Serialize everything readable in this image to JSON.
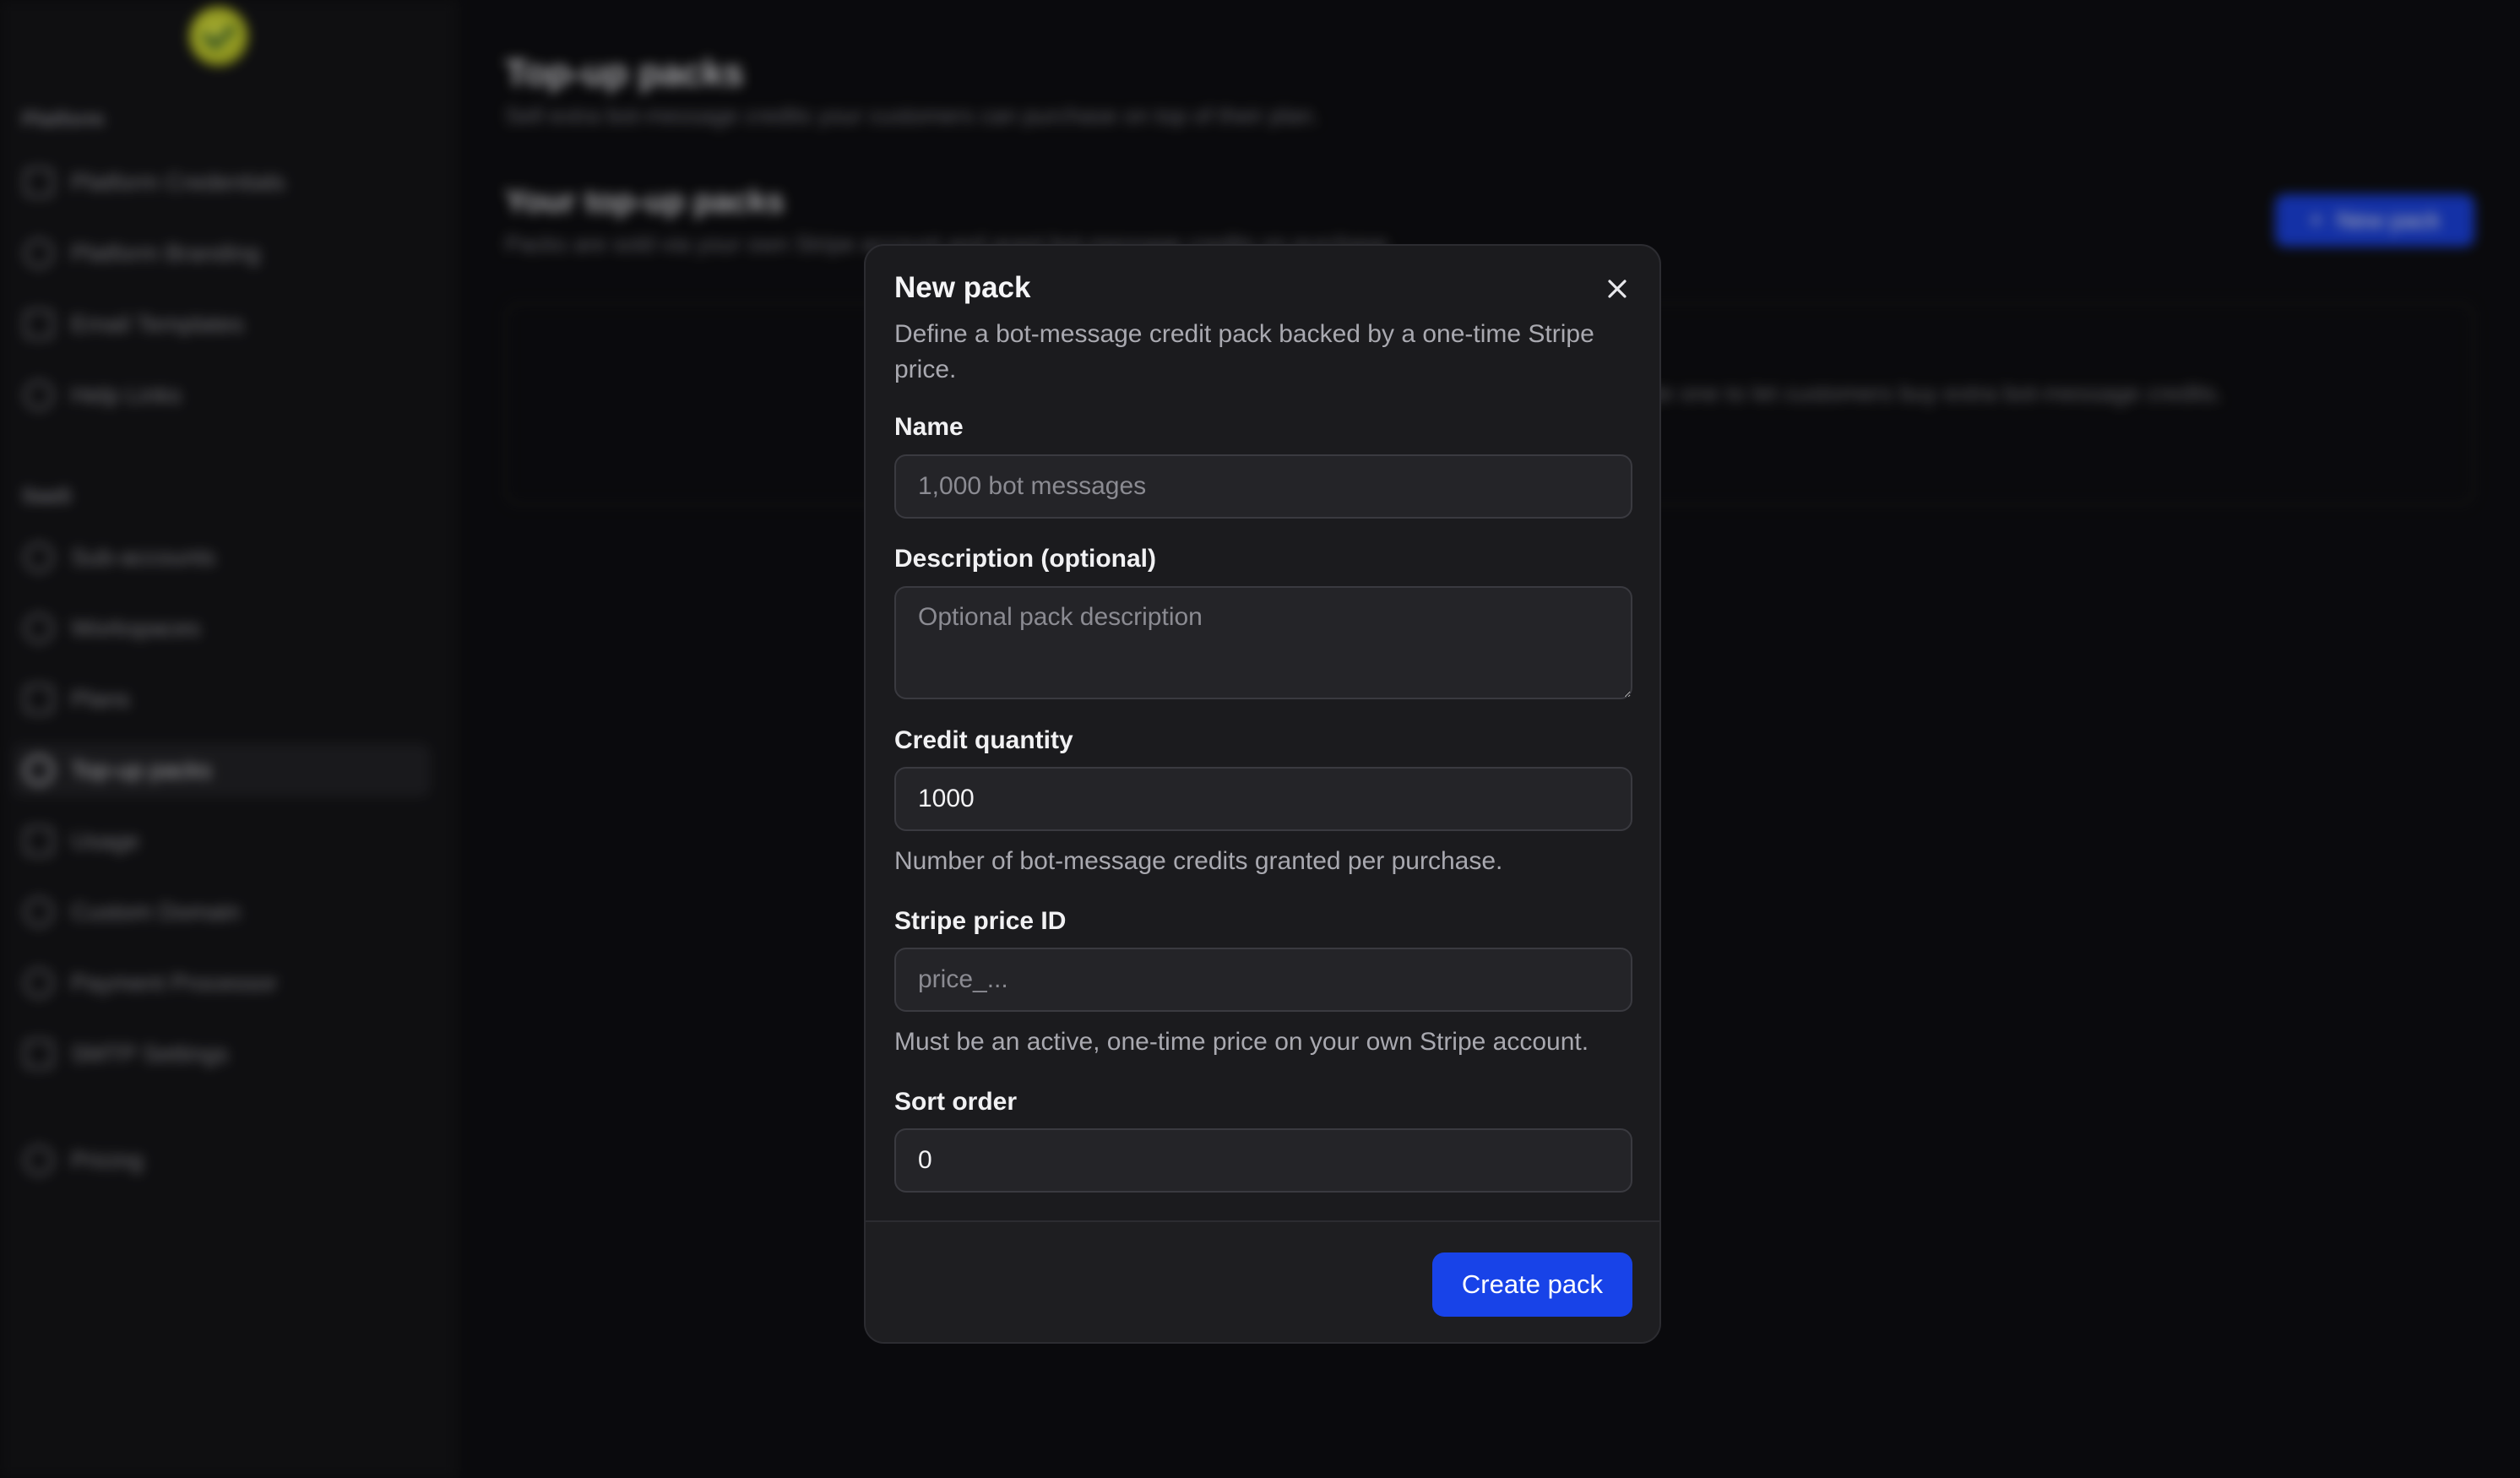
{
  "sidebar": {
    "sections": [
      {
        "label": "Platform",
        "items": [
          {
            "label": "Platform Credentials",
            "icon": "key-icon"
          },
          {
            "label": "Platform Branding",
            "icon": "palette-icon"
          },
          {
            "label": "Email Templates",
            "icon": "mail-icon"
          },
          {
            "label": "Help Links",
            "icon": "help-icon"
          }
        ]
      },
      {
        "label": "SaaS",
        "items": [
          {
            "label": "Sub-accounts",
            "icon": "users-icon"
          },
          {
            "label": "Workspaces",
            "icon": "workspace-icon"
          },
          {
            "label": "Plans",
            "icon": "plans-icon"
          },
          {
            "label": "Top-up packs",
            "icon": "package-icon",
            "active": true
          },
          {
            "label": "Usage",
            "icon": "usage-icon"
          },
          {
            "label": "Custom Domain",
            "icon": "globe-icon"
          },
          {
            "label": "Payment Processor",
            "icon": "card-icon"
          },
          {
            "label": "SMTP Settings",
            "icon": "server-icon"
          }
        ]
      }
    ],
    "footer_item": {
      "label": "Pricing",
      "icon": "tag-icon"
    }
  },
  "main": {
    "title": "Top-up packs",
    "subtitle": "Sell extra bot-message credits your customers can purchase on top of their plan.",
    "section_title": "Your top-up packs",
    "section_subtitle": "Packs are sold via your own Stripe account and grant bot-message credits on purchase.",
    "new_pack_label": "New pack",
    "empty_text": "No packs yet. Create one to let customers buy extra bot-message credits."
  },
  "modal": {
    "title": "New pack",
    "description": "Define a bot-message credit pack backed by a one-time Stripe price.",
    "fields": {
      "name": {
        "label": "Name",
        "value": "",
        "placeholder": "1,000 bot messages"
      },
      "description": {
        "label": "Description (optional)",
        "value": "",
        "placeholder": "Optional pack description"
      },
      "credit_quantity": {
        "label": "Credit quantity",
        "value": "1000",
        "help": "Number of bot-message credits granted per purchase."
      },
      "stripe_price_id": {
        "label": "Stripe price ID",
        "value": "",
        "placeholder": "price_...",
        "help": "Must be an active, one-time price on your own Stripe account."
      },
      "sort_order": {
        "label": "Sort order",
        "value": "0"
      }
    },
    "submit_label": "Create pack"
  },
  "colors": {
    "accent": "#1843e8",
    "modal_bg": "#1b1b1e",
    "page_bg": "#0f0f12"
  }
}
